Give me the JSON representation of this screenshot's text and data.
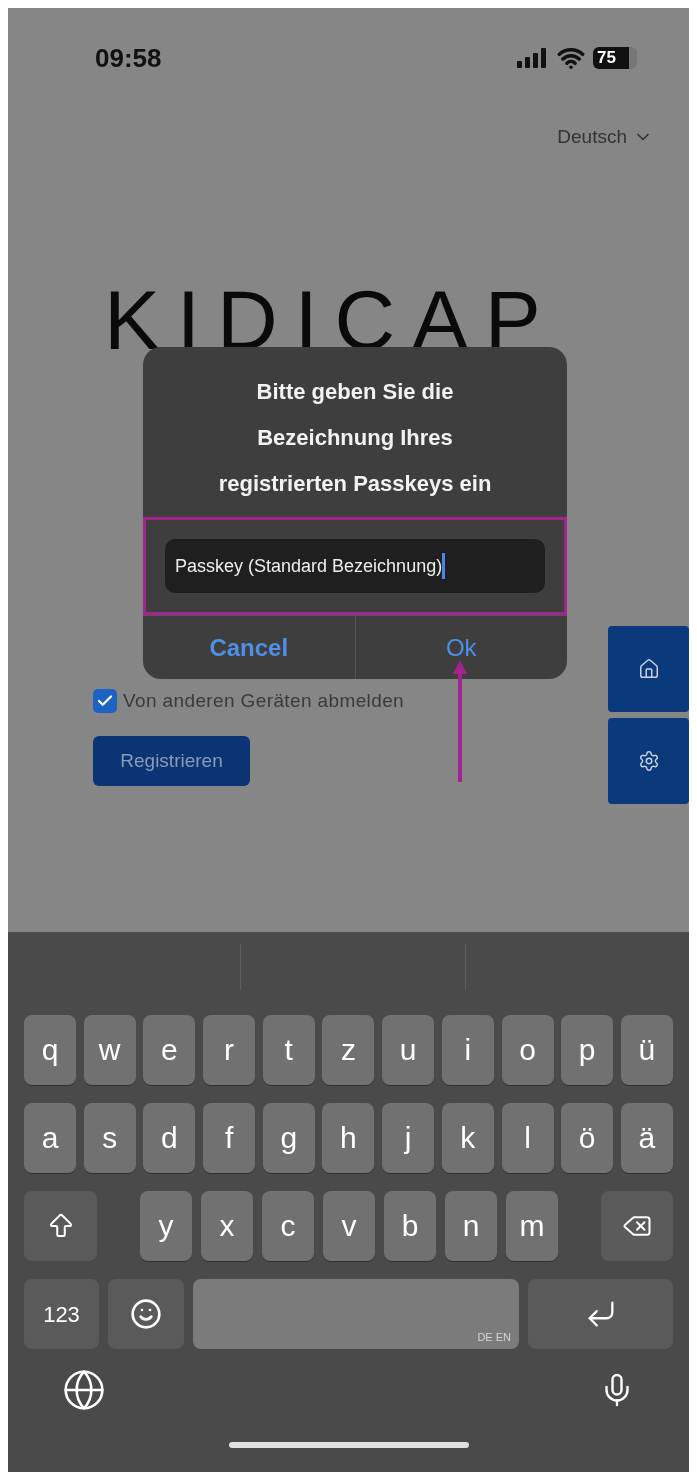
{
  "status_bar": {
    "time": "09:58",
    "battery": "75"
  },
  "language_selector": {
    "label": "Deutsch"
  },
  "logo": "KIDICAP",
  "logout_checkbox": {
    "label": "Von anderen Geräten abmelden",
    "checked": true
  },
  "register_button": "Registrieren",
  "side_buttons": [
    {
      "kind": "home"
    },
    {
      "kind": "settings"
    }
  ],
  "dialog": {
    "title": "Bitte geben Sie die Bezeichnung Ihres registrierten Passkeys ein",
    "input_value": "Passkey (Standard Bezeichnung)",
    "buttons": [
      {
        "label": "Cancel",
        "kind": "cancel"
      },
      {
        "label": "Ok",
        "kind": "confirm"
      }
    ]
  },
  "keyboard": {
    "top_row": [
      "q",
      "w",
      "e",
      "r",
      "t",
      "z",
      "u",
      "i",
      "o",
      "p",
      "ü"
    ],
    "home_row": [
      "a",
      "s",
      "d",
      "f",
      "g",
      "h",
      "j",
      "k",
      "l",
      "ö",
      "ä"
    ],
    "shift_row_letters": [
      "y",
      "x",
      "c",
      "v",
      "b",
      "n",
      "m"
    ],
    "numbers_key": "123",
    "space_label": "DE EN"
  }
}
